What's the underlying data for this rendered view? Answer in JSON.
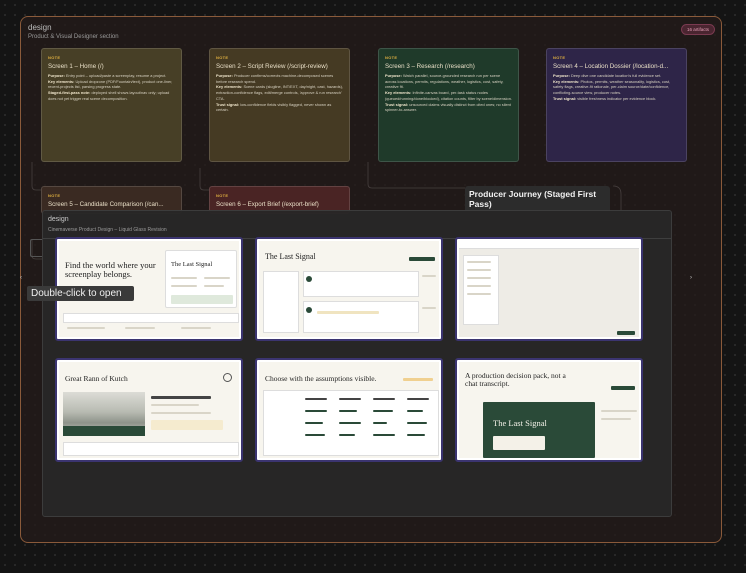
{
  "section": {
    "title": "design",
    "subtitle": "Product & Visual Designer section",
    "badge": "16 artifacts"
  },
  "notes": [
    {
      "tag": "NOTE",
      "title": "Screen 1 – Home (/)",
      "lines": [
        {
          "label": "Purpose:",
          "text": " Entry point – upload/paste a screenplay, resume a project."
        },
        {
          "label": "Key elements:",
          "text": " Upload dropzone (PDF/Fountain/text), product one-liner, recent-projects list, parsing progress state."
        },
        {
          "label": "Staged-first-pass note:",
          "text": " deployed shell shows layout/nav only; upload does not yet trigger real scene decomposition."
        }
      ]
    },
    {
      "tag": "NOTE",
      "title": "Screen 2 – Script Review (/script-review)",
      "lines": [
        {
          "label": "Purpose:",
          "text": " Producer confirms/corrects machine-decomposed scenes before research spend."
        },
        {
          "label": "Key elements:",
          "text": " Scene cards (slugline, INT/EXT, day/night, cast, hazards), extraction-confidence flags, edit/merge controls, 'approve & run research' CTA."
        },
        {
          "label": "Trust signal:",
          "text": " low-confidence fields visibly flagged, never shown as certain."
        }
      ]
    },
    {
      "tag": "NOTE",
      "title": "Screen 3 – Research (/research)",
      "lines": [
        {
          "label": "Purpose:",
          "text": " Watch parallel, source-grounded research run per scene across locations, permits, regulations, weather, logistics, cost, safety, creative fit."
        },
        {
          "label": "Key elements:",
          "text": " Infinite-canvas board, per-task status nodes (queued/running/done/blocked), citation counts, filter by scene/dimension."
        },
        {
          "label": "Trust signal:",
          "text": " unsourced claims visually distinct from cited ones; no silent spinner-to-answer."
        }
      ]
    },
    {
      "tag": "NOTE",
      "title": "Screen 4 – Location Dossier (/location-d...",
      "lines": [
        {
          "label": "Purpose:",
          "text": " Deep dive one candidate location's full evidence set."
        },
        {
          "label": "Key elements:",
          "text": " Photos, permits, weather seasonality, logistics, cost, safety flags, creative-fit rationale, per-claim source/date/confidence, conflicting-source view, producer notes."
        },
        {
          "label": "Trust signal:",
          "text": " visible freshness indicator per evidence block."
        }
      ]
    },
    {
      "tag": "NOTE",
      "title": "Screen 5 – Candidate Comparison (/can...",
      "lines": []
    },
    {
      "tag": "NOTE",
      "title": "Screen 6 – Export Brief (/export-brief)",
      "lines": []
    }
  ],
  "journey": {
    "title": "Producer Journey (Staged First Pass)"
  },
  "frame": {
    "title": "design",
    "subtitle": "Cinemaverse Product Design – Liquid Glass Revision"
  },
  "tooltip": "Double-click to open",
  "screens": {
    "home_headline": "Find the world where your screenplay belongs.",
    "home_project": "The Last Signal",
    "review_title": "The Last Signal",
    "dossier_title": "Great Rann of Kutch",
    "compare_headline": "Choose with the assumptions visible.",
    "export_headline": "A production decision pack, not a chat transcript.",
    "export_cover": "The Last Signal"
  }
}
